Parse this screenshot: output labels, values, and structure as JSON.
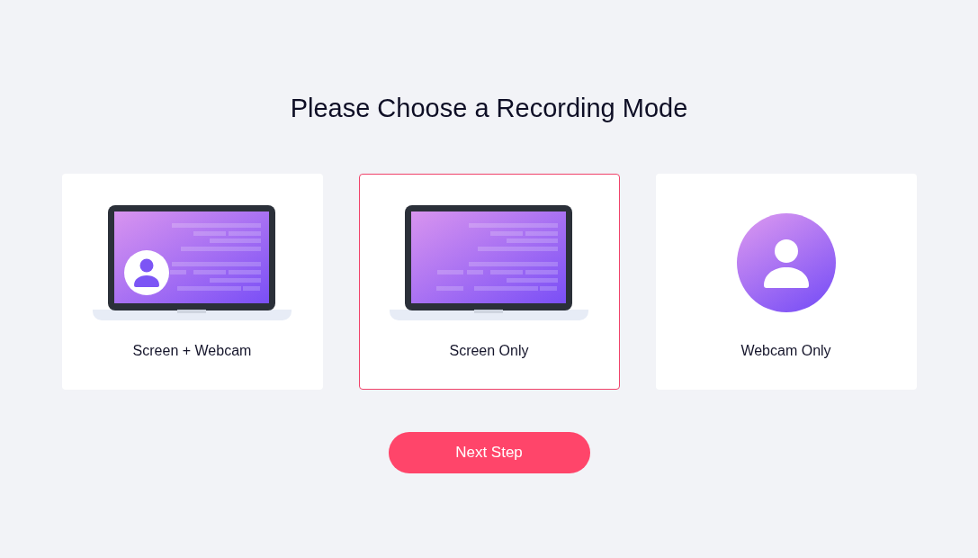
{
  "title": "Please Choose a Recording Mode",
  "modes": [
    {
      "label": "Screen + Webcam",
      "kind": "screen_webcam",
      "selected": false
    },
    {
      "label": "Screen Only",
      "kind": "screen",
      "selected": true
    },
    {
      "label": "Webcam Only",
      "kind": "webcam",
      "selected": false
    }
  ],
  "next_button": {
    "label": "Next Step"
  }
}
